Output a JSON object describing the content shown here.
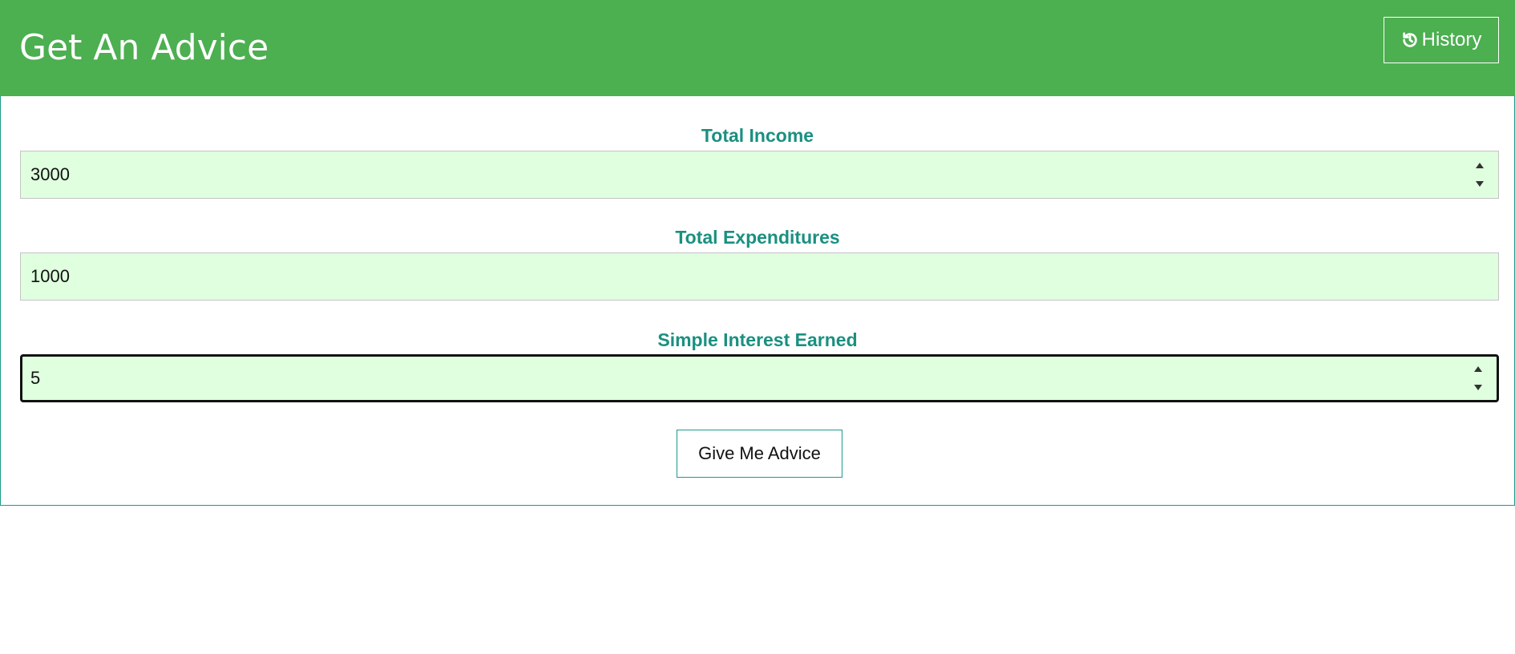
{
  "header": {
    "title": "Get An Advice",
    "history_label": "History",
    "history_icon": "history-icon",
    "background_color": "#4caf50"
  },
  "form": {
    "income": {
      "label": "Total Income",
      "value": "3000"
    },
    "expenditures": {
      "label": "Total Expenditures",
      "value": "1000"
    },
    "interest": {
      "label": "Simple Interest Earned",
      "value": "5"
    },
    "submit_label": "Give Me Advice",
    "label_color": "#1a9080",
    "input_background": "#dfffdf"
  }
}
